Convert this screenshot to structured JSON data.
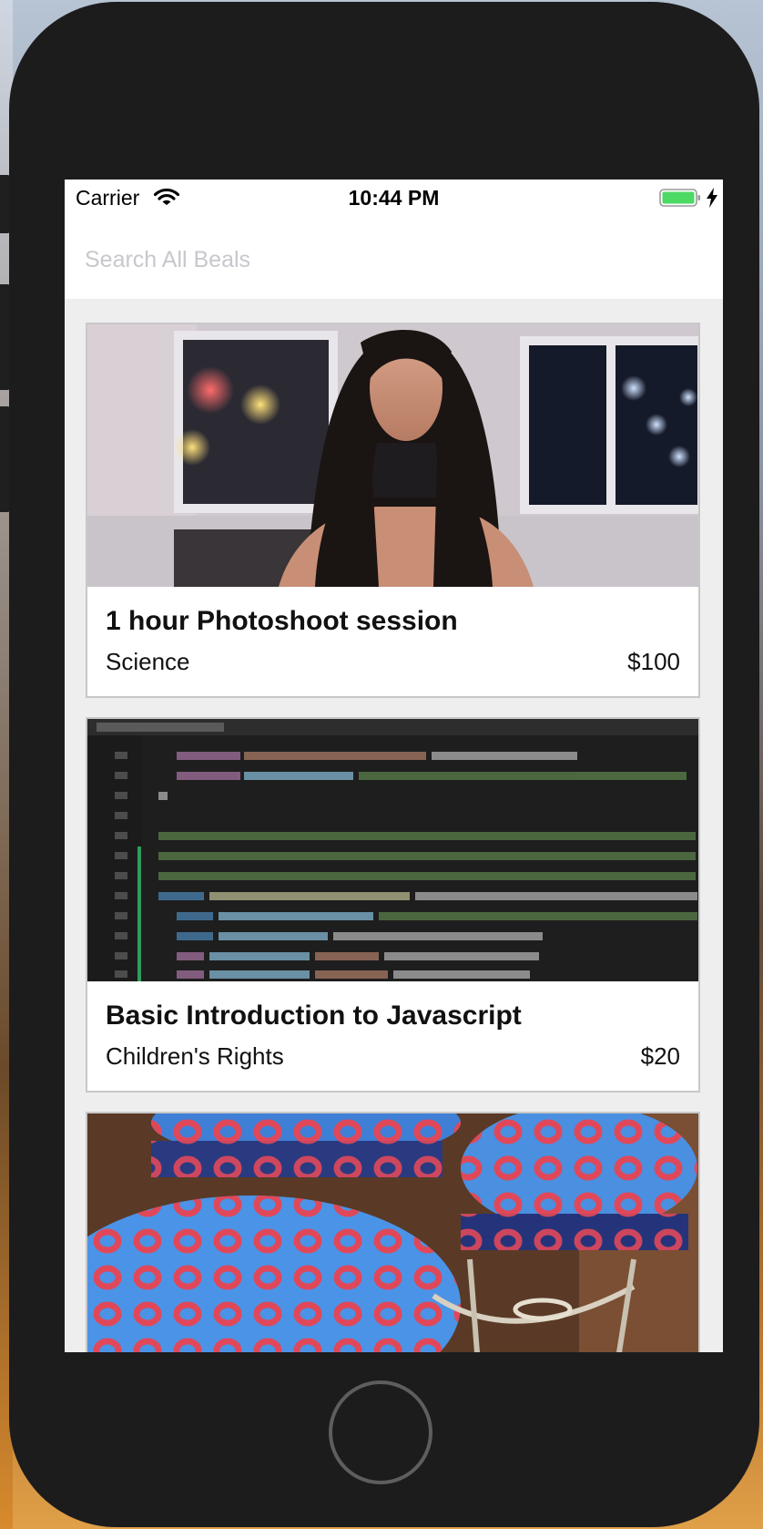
{
  "status_bar": {
    "carrier": "Carrier",
    "time": "10:44 PM"
  },
  "search": {
    "placeholder": "Search All Beals",
    "value": ""
  },
  "listings": [
    {
      "title": "1 hour Photoshoot session",
      "category": "Science",
      "price": "$100",
      "image": "portrait-photo"
    },
    {
      "title": "Basic Introduction to Javascript",
      "category": "Children's Rights",
      "price": "$20",
      "image": "code-screenshot"
    },
    {
      "title": "",
      "category": "",
      "price": "",
      "image": "blue-stools-photo"
    }
  ],
  "colors": {
    "phone_body": "#1c1c1d",
    "battery_fill": "#4cd964",
    "placeholder": "#c7c7cd",
    "card_border": "#c8c8c8",
    "list_background": "#eeeeee"
  }
}
